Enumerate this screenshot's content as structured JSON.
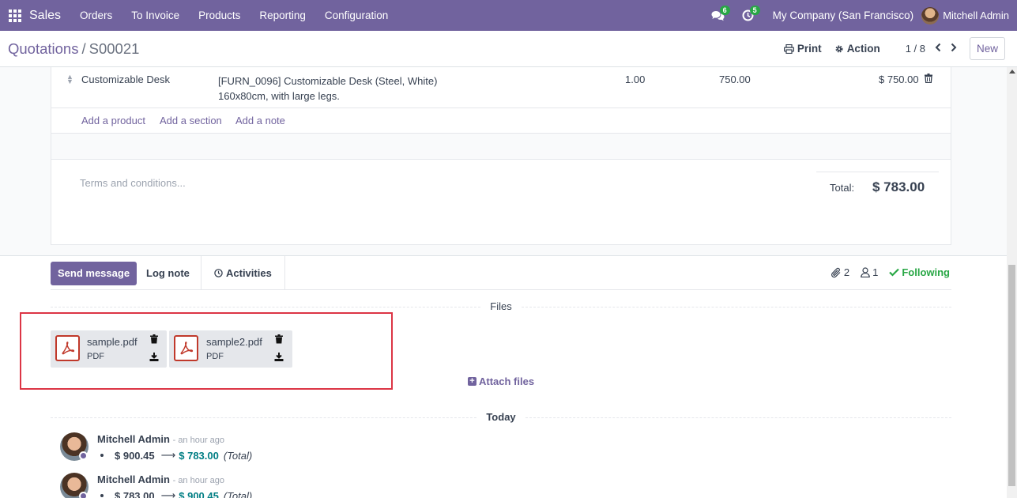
{
  "navbar": {
    "app_name": "Sales",
    "menu": [
      "Orders",
      "To Invoice",
      "Products",
      "Reporting",
      "Configuration"
    ],
    "messages_count": "6",
    "activities_count": "5",
    "company": "My Company (San Francisco)",
    "user": "Mitchell Admin",
    "brand_color": "#71639e"
  },
  "control_panel": {
    "breadcrumb_parent": "Quotations",
    "breadcrumb_sep": "/",
    "breadcrumb_current": "S00021",
    "print_label": "Print",
    "action_label": "Action",
    "pager": "1 / 8",
    "new_label": "New"
  },
  "order_line": {
    "product": "Customizable Desk",
    "description_line1": "[FURN_0096] Customizable Desk (Steel, White)",
    "description_line2": "160x80cm, with large legs.",
    "quantity": "1.00",
    "unit_price": "750.00",
    "subtotal": "$ 750.00"
  },
  "add_links": {
    "product": "Add a product",
    "section": "Add a section",
    "note": "Add a note"
  },
  "terms_placeholder": "Terms and conditions...",
  "totals": {
    "label": "Total:",
    "value": "$ 783.00"
  },
  "chatter": {
    "send_message": "Send message",
    "log_note": "Log note",
    "activities": "Activities",
    "attachments_count": "2",
    "followers_count": "1",
    "following_label": "Following",
    "files_label": "Files",
    "attachments": [
      {
        "name": "sample.pdf",
        "ext": "PDF"
      },
      {
        "name": "sample2.pdf",
        "ext": "PDF"
      }
    ],
    "attach_files_label": "Attach files",
    "today_label": "Today",
    "messages": [
      {
        "author": "Mitchell Admin",
        "time": "- an hour ago",
        "old": "$ 900.45",
        "new": "$ 783.00",
        "field": "(Total)"
      },
      {
        "author": "Mitchell Admin",
        "time": "- an hour ago",
        "old": "$ 783.00",
        "new": "$ 900.45",
        "field": "(Total)"
      }
    ]
  }
}
